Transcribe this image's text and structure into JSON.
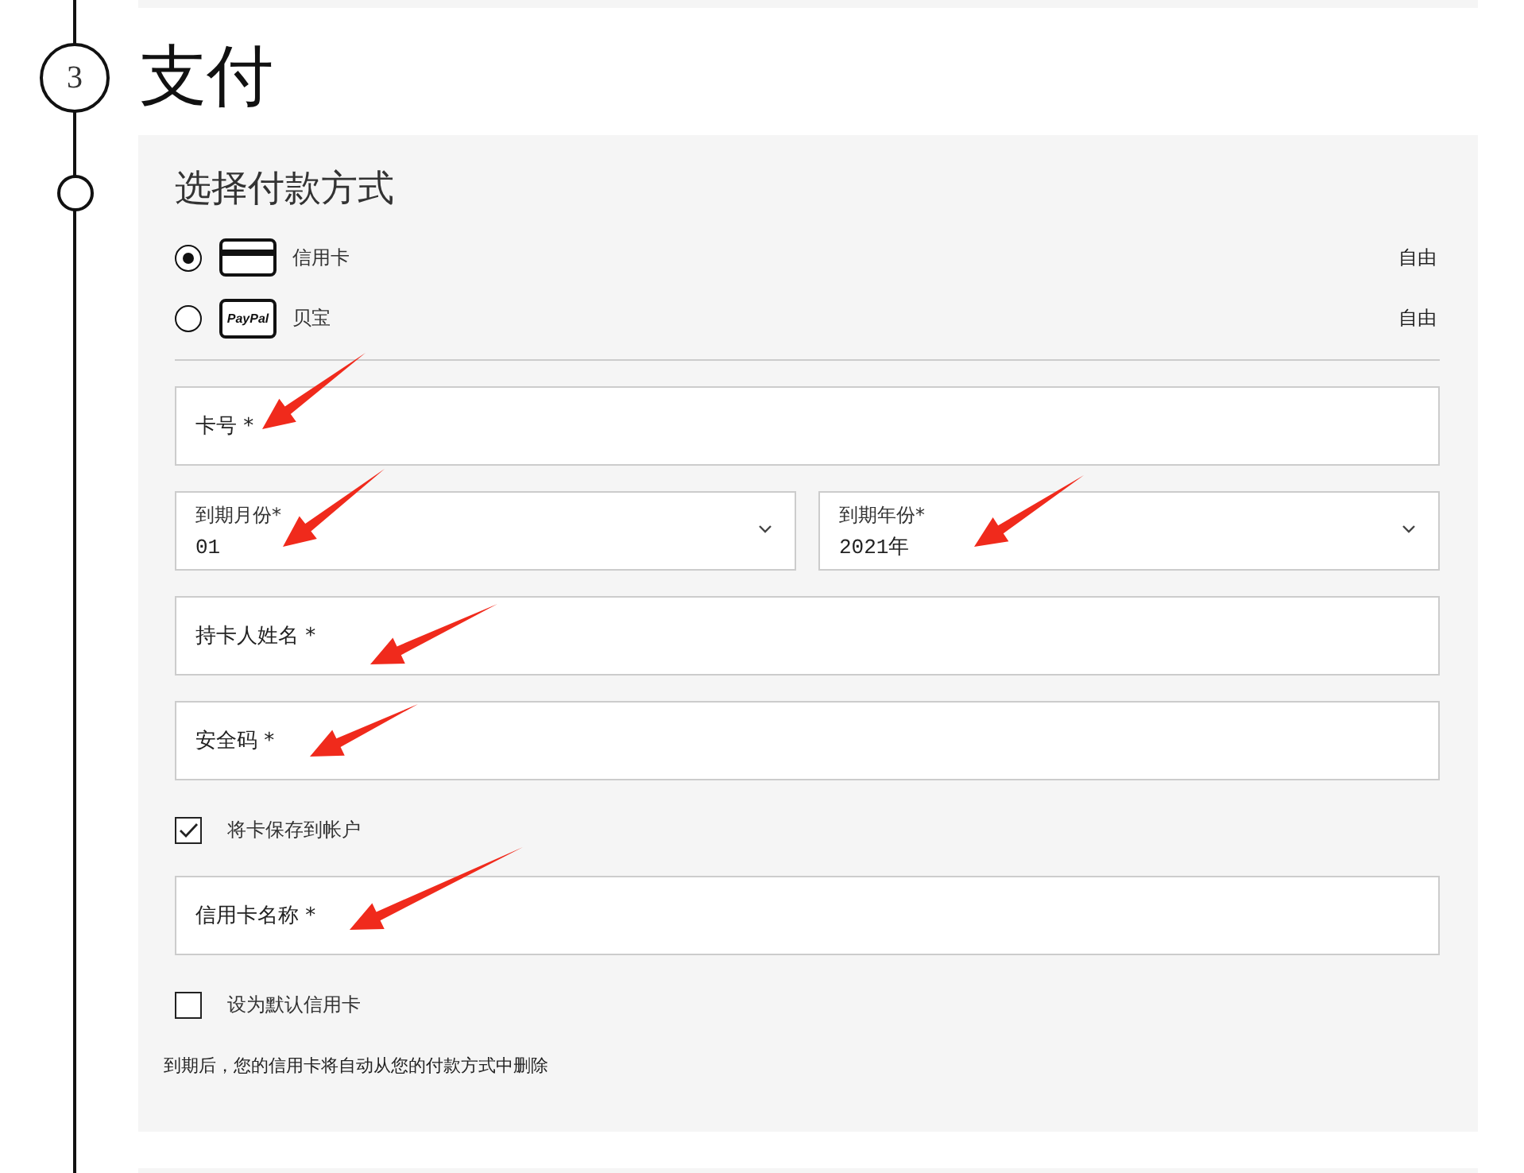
{
  "step": {
    "number": "3",
    "title": "支付"
  },
  "payment": {
    "heading": "选择付款方式",
    "methods": [
      {
        "kind": "card",
        "label": "信用卡",
        "price": "自由",
        "selected": true
      },
      {
        "kind": "paypal",
        "badge": "PayPal",
        "label": "贝宝",
        "price": "自由",
        "selected": false
      }
    ],
    "form": [
      {
        "kind": "input",
        "label": "卡号 *"
      },
      {
        "kind": "selects",
        "items": [
          {
            "label": "到期月份*",
            "value": "01"
          },
          {
            "label": "到期年份*",
            "value": "2021年"
          }
        ]
      },
      {
        "kind": "input",
        "label": "持卡人姓名 *"
      },
      {
        "kind": "input",
        "label": "安全码 *"
      },
      {
        "kind": "checkbox",
        "label": "将卡保存到帐户",
        "checked": true
      },
      {
        "kind": "input",
        "label": "信用卡名称 *"
      },
      {
        "kind": "checkbox",
        "label": "设为默认信用卡",
        "checked": false
      },
      {
        "kind": "note",
        "text": "到期后，您的信用卡将自动从您的付款方式中删除"
      }
    ]
  }
}
